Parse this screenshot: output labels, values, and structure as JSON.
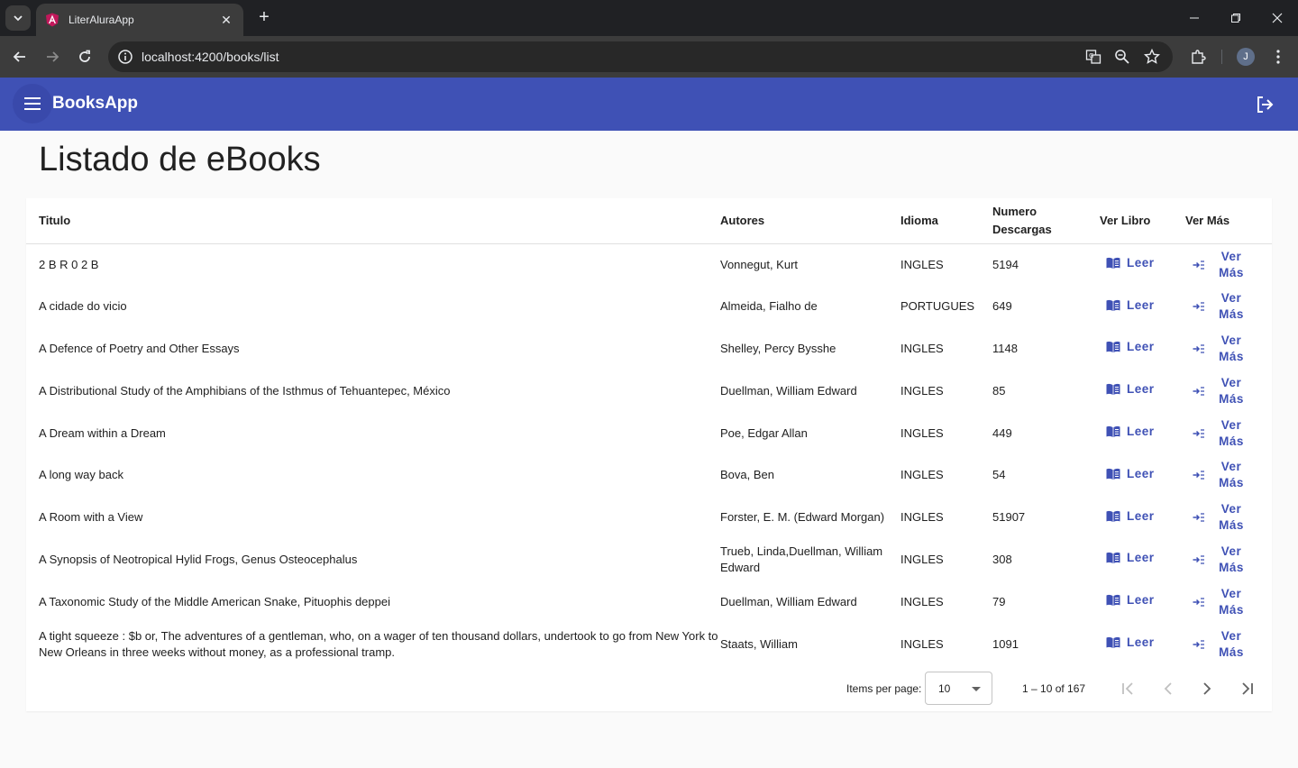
{
  "browser": {
    "tab_title": "LiterAluraApp",
    "url": "localhost:4200/books/list",
    "profile_initial": "J"
  },
  "app": {
    "title": "BooksApp",
    "accent_color": "#3f51b5"
  },
  "page": {
    "title": "Listado de eBooks"
  },
  "table": {
    "headers": {
      "titulo": "Titulo",
      "autores": "Autores",
      "idioma": "Idioma",
      "descargas_line1": "Numero",
      "descargas_line2": "Descargas",
      "ver_libro": "Ver Libro",
      "ver_mas": "Ver Más"
    },
    "leer_label": "Leer",
    "ver_label": "Ver",
    "mas_label": "Más",
    "rows": [
      {
        "titulo": "2 B R 0 2 B",
        "autores": "Vonnegut, Kurt",
        "idioma": "INGLES",
        "descargas": "5194"
      },
      {
        "titulo": "A cidade do vicio",
        "autores": "Almeida, Fialho de",
        "idioma": "PORTUGUES",
        "descargas": "649"
      },
      {
        "titulo": "A Defence of Poetry and Other Essays",
        "autores": "Shelley, Percy Bysshe",
        "idioma": "INGLES",
        "descargas": "1148"
      },
      {
        "titulo": "A Distributional Study of the Amphibians of the Isthmus of Tehuantepec, México",
        "autores": "Duellman, William Edward",
        "idioma": "INGLES",
        "descargas": "85"
      },
      {
        "titulo": "A Dream within a Dream",
        "autores": "Poe, Edgar Allan",
        "idioma": "INGLES",
        "descargas": "449"
      },
      {
        "titulo": "A long way back",
        "autores": "Bova, Ben",
        "idioma": "INGLES",
        "descargas": "54"
      },
      {
        "titulo": "A Room with a View",
        "autores": "Forster, E. M. (Edward Morgan)",
        "idioma": "INGLES",
        "descargas": "51907"
      },
      {
        "titulo": "A Synopsis of Neotropical Hylid Frogs, Genus Osteocephalus",
        "autores": "Trueb, Linda,Duellman, William Edward",
        "idioma": "INGLES",
        "descargas": "308"
      },
      {
        "titulo": "A Taxonomic Study of the Middle American Snake, Pituophis deppei",
        "autores": "Duellman, William Edward",
        "idioma": "INGLES",
        "descargas": "79"
      },
      {
        "titulo": "A tight squeeze : $b or, The adventures of a gentleman, who, on a wager of ten thousand dollars, undertook to go from New York to New Orleans in three weeks without money, as a professional tramp.",
        "autores": "Staats, William",
        "idioma": "INGLES",
        "descargas": "1091"
      }
    ]
  },
  "paginator": {
    "items_per_page_label": "Items per page:",
    "page_size": "10",
    "range_label": "1 – 10 of 167"
  }
}
